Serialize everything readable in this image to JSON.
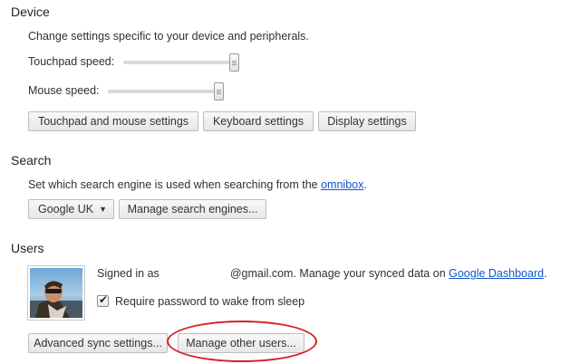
{
  "device": {
    "title": "Device",
    "description": "Change settings specific to your device and peripherals.",
    "touchpad_speed_label": "Touchpad speed:",
    "touchpad_speed_value": 1.0,
    "mouse_speed_label": "Mouse speed:",
    "mouse_speed_value": 1.0,
    "buttons": {
      "touchpad_mouse": "Touchpad and mouse settings",
      "keyboard": "Keyboard settings",
      "display": "Display settings"
    }
  },
  "search": {
    "title": "Search",
    "description_prefix": "Set which search engine is used when searching from the ",
    "description_link": "omnibox",
    "description_suffix": ".",
    "engine_selected": "Google UK",
    "manage_button": "Manage search engines..."
  },
  "users": {
    "title": "Users",
    "signed_in_prefix": "Signed in as",
    "email_suffix": "@gmail.com.",
    "manage_text": "Manage your synced data on",
    "dashboard_link": "Google Dashboard",
    "dashboard_suffix": ".",
    "require_password_label": "Require password to wake from sleep",
    "require_password_checked": true,
    "advanced_sync_button": "Advanced sync settings...",
    "manage_users_button": "Manage other users..."
  },
  "annotation": {
    "highlight_color": "#d42020"
  }
}
